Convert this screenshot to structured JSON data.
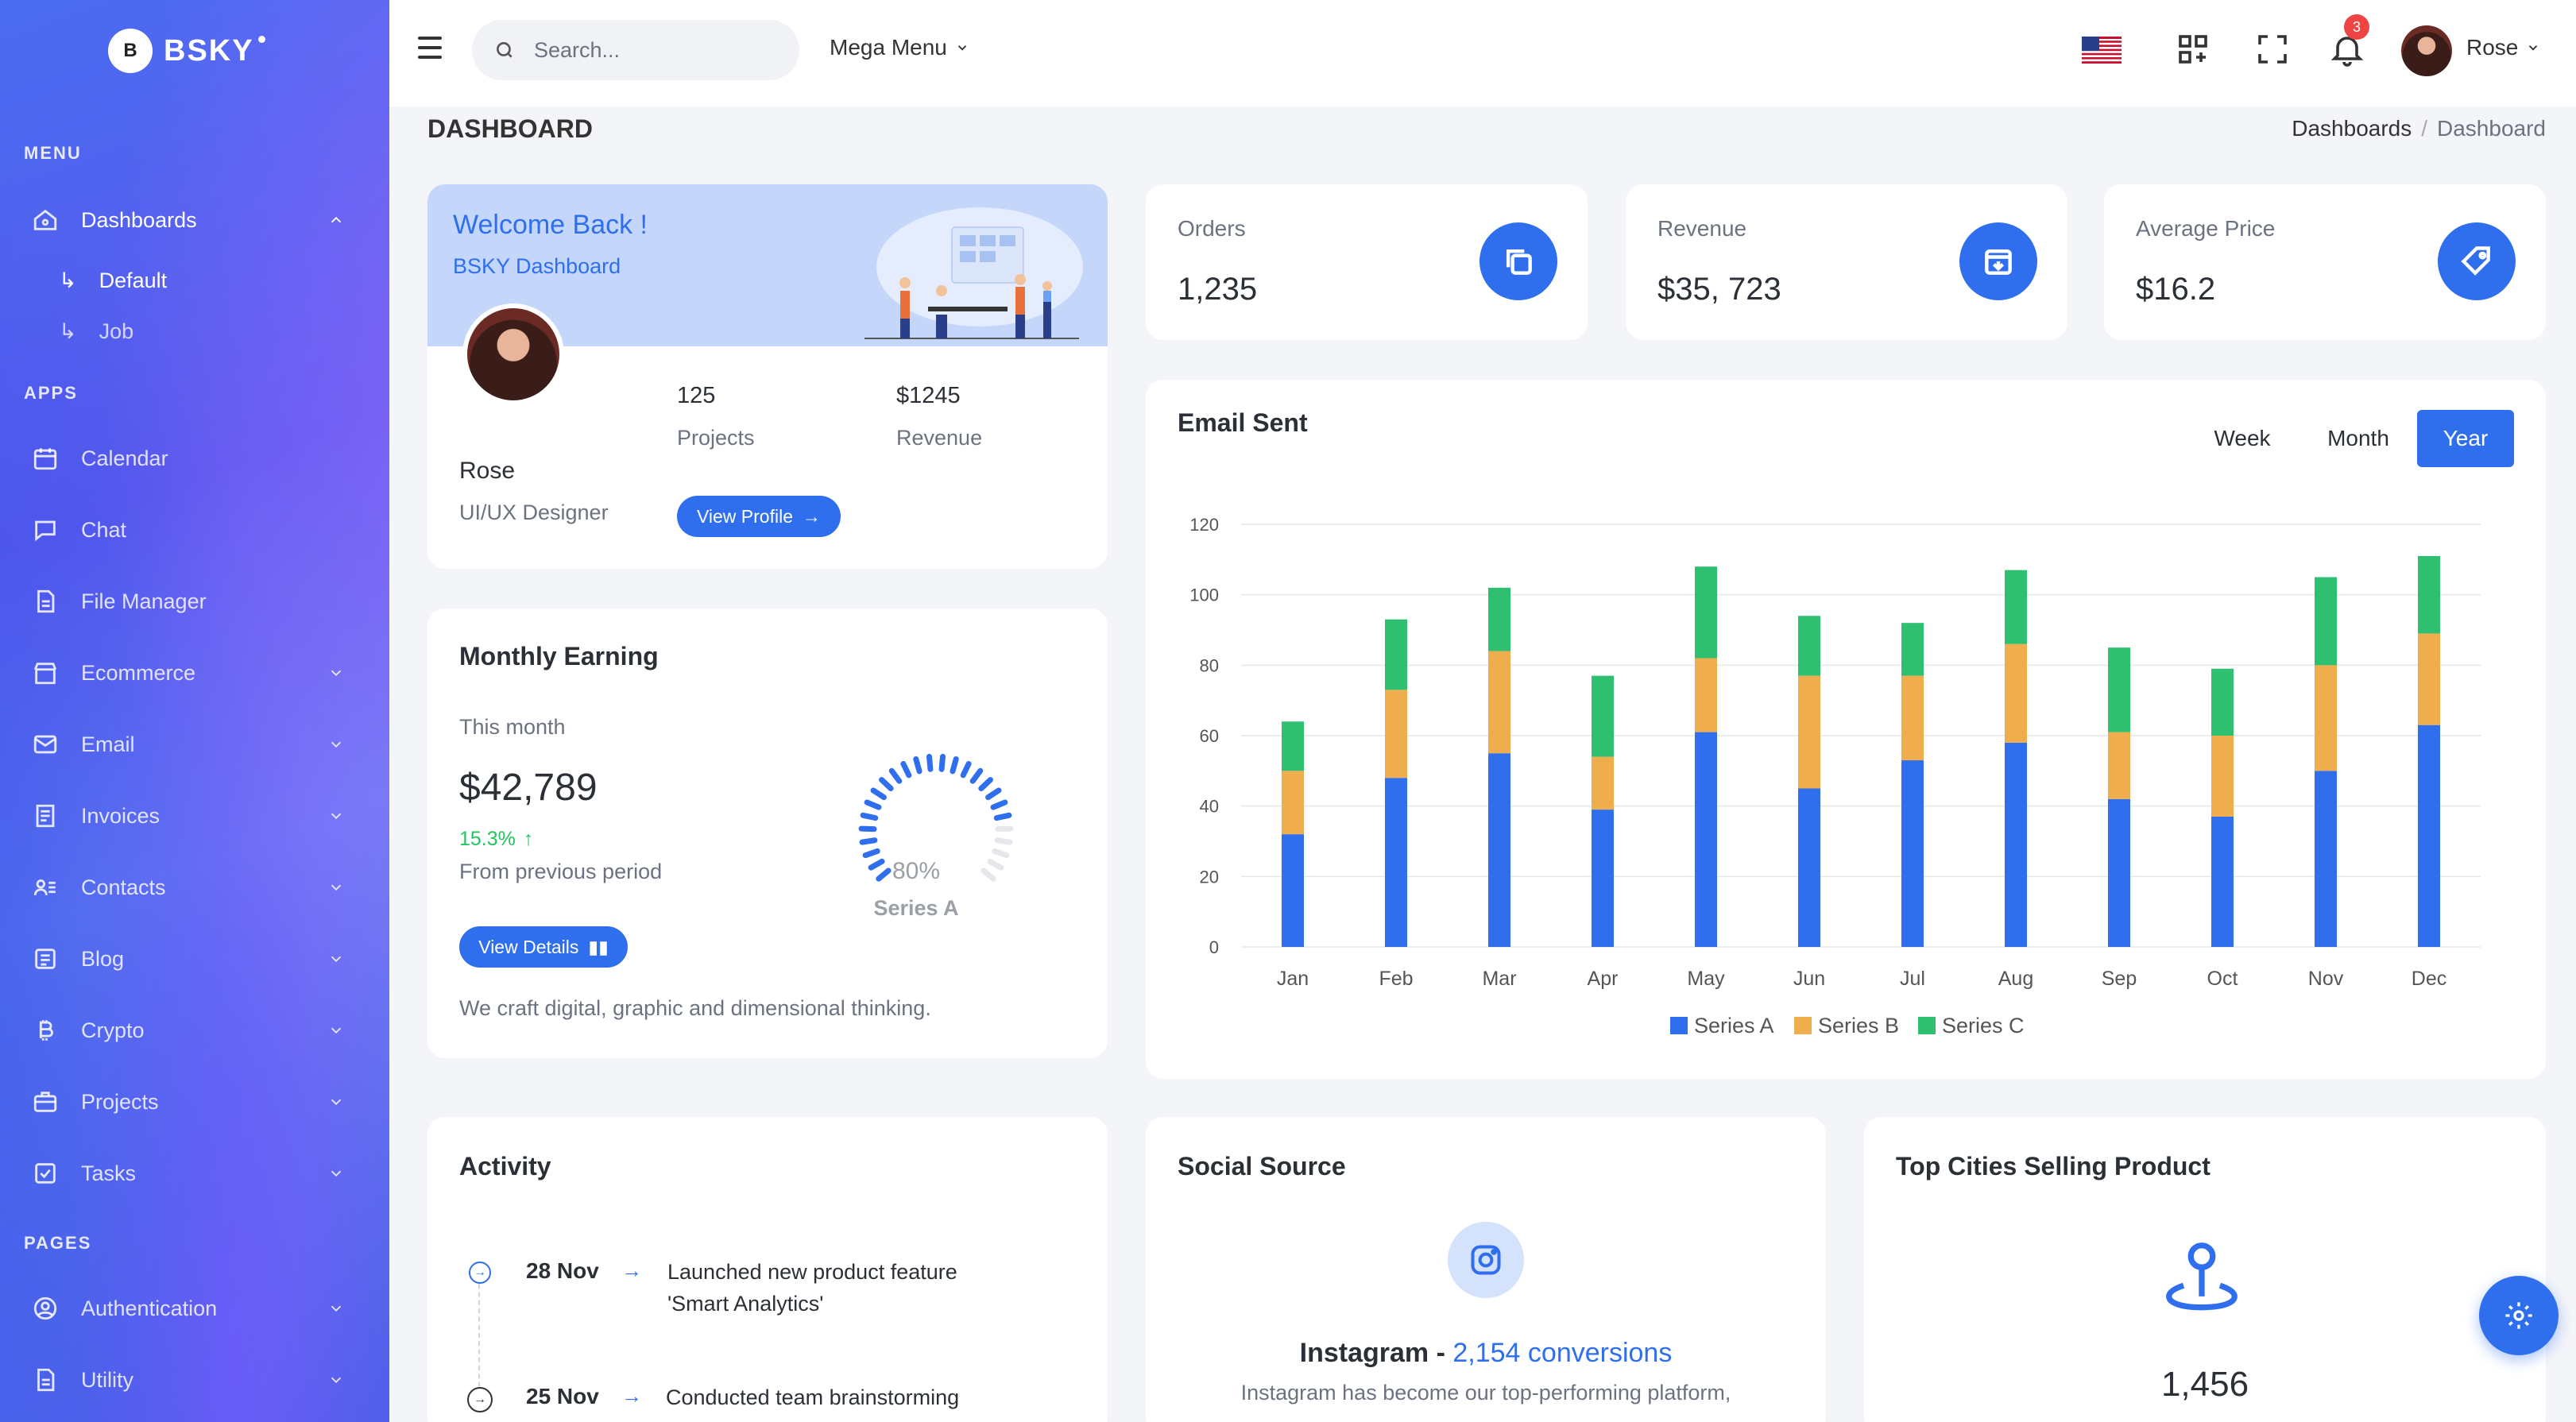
{
  "brand": {
    "initial": "B",
    "name": "BSKY"
  },
  "sidebar": {
    "menu_title": "MENU",
    "apps_title": "APPS",
    "pages_title": "PAGES",
    "dashboards": "Dashboards",
    "sub_default": "Default",
    "sub_job": "Job",
    "items": [
      {
        "label": "Calendar"
      },
      {
        "label": "Chat"
      },
      {
        "label": "File Manager"
      },
      {
        "label": "Ecommerce"
      },
      {
        "label": "Email"
      },
      {
        "label": "Invoices"
      },
      {
        "label": "Contacts"
      },
      {
        "label": "Blog"
      },
      {
        "label": "Crypto"
      },
      {
        "label": "Projects"
      },
      {
        "label": "Tasks"
      }
    ],
    "pages": [
      {
        "label": "Authentication"
      },
      {
        "label": "Utility"
      }
    ]
  },
  "topbar": {
    "search_placeholder": "Search...",
    "mega_menu": "Mega Menu",
    "notif_count": "3",
    "user": "Rose"
  },
  "page": {
    "title": "DASHBOARD",
    "breadcrumb_parent": "Dashboards",
    "breadcrumb_sep": "/",
    "breadcrumb_current": "Dashboard"
  },
  "welcome": {
    "title": "Welcome Back !",
    "subtitle": "BSKY Dashboard",
    "name": "Rose",
    "role": "UI/UX Designer",
    "projects_value": "125",
    "projects_label": "Projects",
    "revenue_value": "$1245",
    "revenue_label": "Revenue",
    "button": "View Profile"
  },
  "stats": [
    {
      "label": "Orders",
      "value": "1,235"
    },
    {
      "label": "Revenue",
      "value": "$35, 723"
    },
    {
      "label": "Average Price",
      "value": "$16.2"
    }
  ],
  "earning": {
    "title": "Monthly Earning",
    "period": "This month",
    "value": "$42,789",
    "change": "15.3%",
    "change_note": "From previous period",
    "gauge_value": "80%",
    "gauge_fraction": 0.8,
    "gauge_label": "Series A",
    "button": "View Details",
    "footer": "We craft digital, graphic and dimensional thinking."
  },
  "email": {
    "title": "Email Sent",
    "tabs": {
      "week": "Week",
      "month": "Month",
      "year": "Year"
    }
  },
  "chart_data": {
    "type": "bar",
    "stacked": true,
    "categories": [
      "Jan",
      "Feb",
      "Mar",
      "Apr",
      "May",
      "Jun",
      "Jul",
      "Aug",
      "Sep",
      "Oct",
      "Nov",
      "Dec"
    ],
    "series": [
      {
        "name": "Series A",
        "color": "#2f6fed",
        "values": [
          32,
          48,
          55,
          39,
          61,
          45,
          53,
          58,
          42,
          37,
          50,
          63
        ]
      },
      {
        "name": "Series B",
        "color": "#f0ad4e",
        "values": [
          18,
          25,
          29,
          15,
          21,
          32,
          24,
          28,
          19,
          23,
          30,
          26
        ]
      },
      {
        "name": "Series C",
        "color": "#2fbf71",
        "values": [
          14,
          20,
          18,
          23,
          26,
          17,
          15,
          21,
          24,
          19,
          25,
          22
        ]
      }
    ],
    "ylim": [
      0,
      120
    ],
    "yticks": [
      "0",
      "20",
      "40",
      "60",
      "80",
      "100",
      "120"
    ],
    "grid": true,
    "legend": "bottom-center"
  },
  "activity": {
    "title": "Activity",
    "items": [
      {
        "date": "28 Nov",
        "text1": "Launched new product feature",
        "text2": "'Smart Analytics'"
      },
      {
        "date": "25 Nov",
        "text1": "Conducted team brainstorming",
        "text2": ""
      }
    ]
  },
  "social": {
    "title": "Social Source",
    "platform": "Instagram",
    "sep": " - ",
    "conversions": "2,154 conversions",
    "desc": "Instagram has become our top-performing platform,"
  },
  "cities": {
    "title": "Top Cities Selling Product",
    "value": "1,456"
  }
}
